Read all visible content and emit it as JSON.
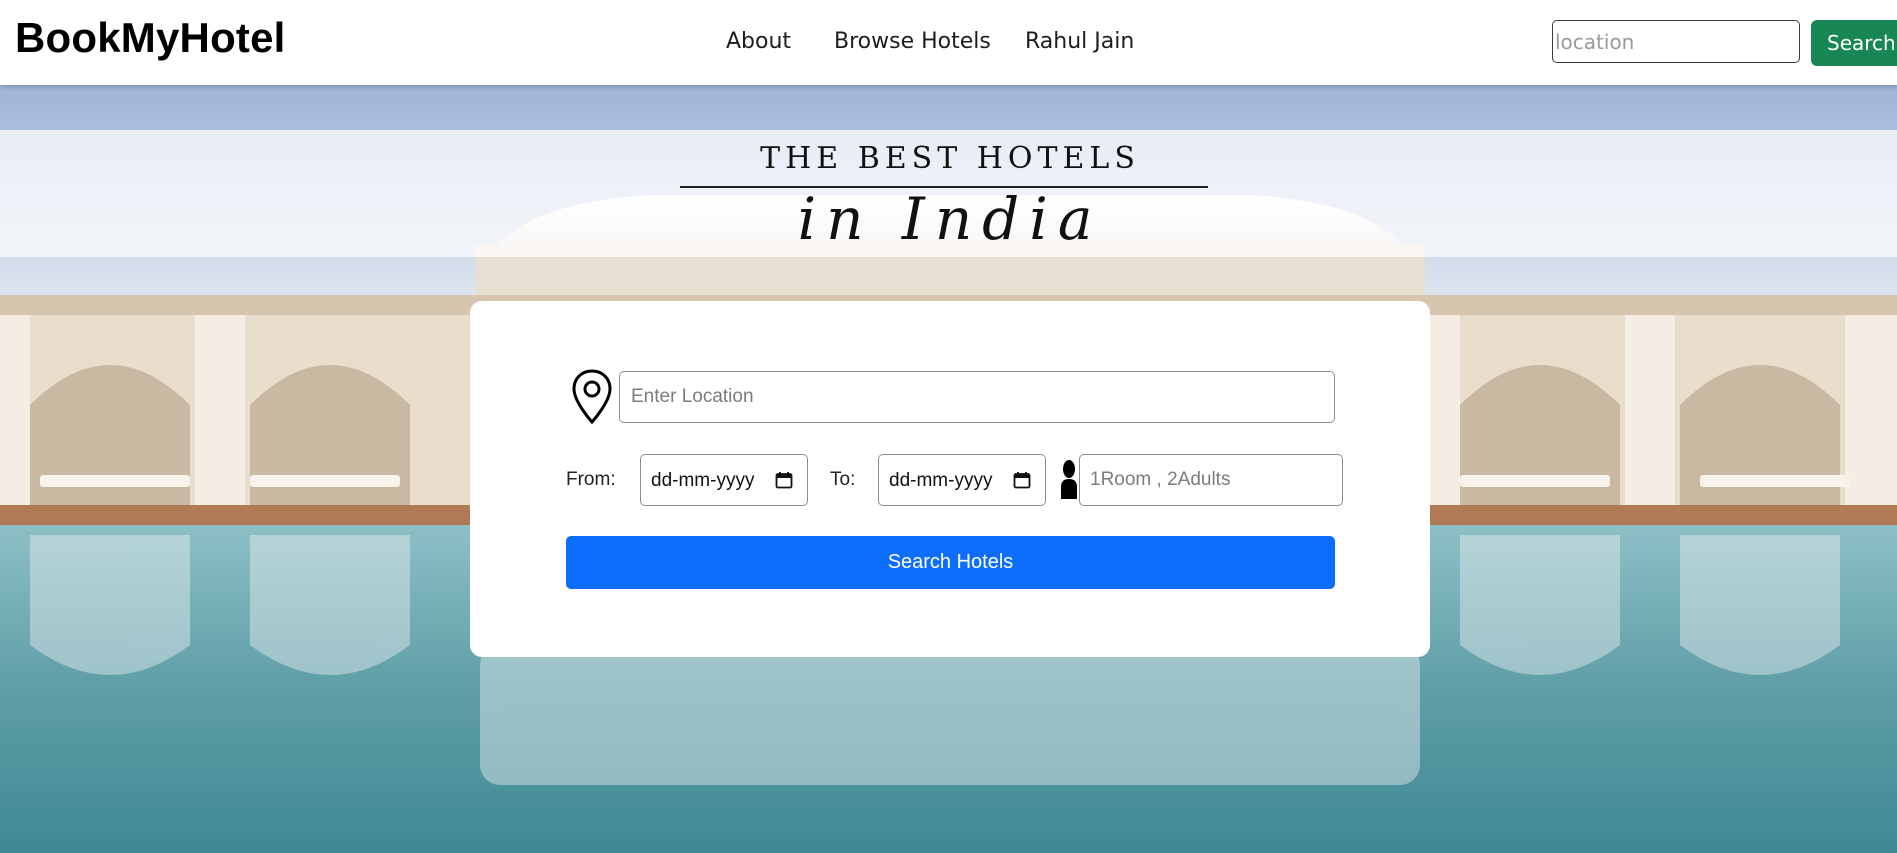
{
  "navbar": {
    "brand": "BookMyHotel",
    "links": [
      {
        "label": "About"
      },
      {
        "label": "Browse Hotels"
      },
      {
        "label": "Rahul Jain"
      }
    ],
    "search": {
      "placeholder": "location",
      "value": "",
      "button_label": "Search"
    }
  },
  "hero": {
    "headline": "THE BEST HOTELS",
    "subline": "in India"
  },
  "booking_form": {
    "location": {
      "placeholder": "Enter Location",
      "value": "",
      "icon": "map-pin-icon"
    },
    "from": {
      "label": "From:",
      "value": "dd-mm-yyyy",
      "icon": "calendar-icon"
    },
    "to": {
      "label": "To:",
      "value": "dd-mm-yyyy",
      "icon": "calendar-icon"
    },
    "guests": {
      "placeholder": "1Room , 2Adults",
      "value": "",
      "icon": "person-icon"
    },
    "submit_label": "Search Hotels"
  },
  "colors": {
    "search_green": "#198754",
    "primary_blue": "#0d6efd",
    "card_bg": "#ffffff"
  }
}
